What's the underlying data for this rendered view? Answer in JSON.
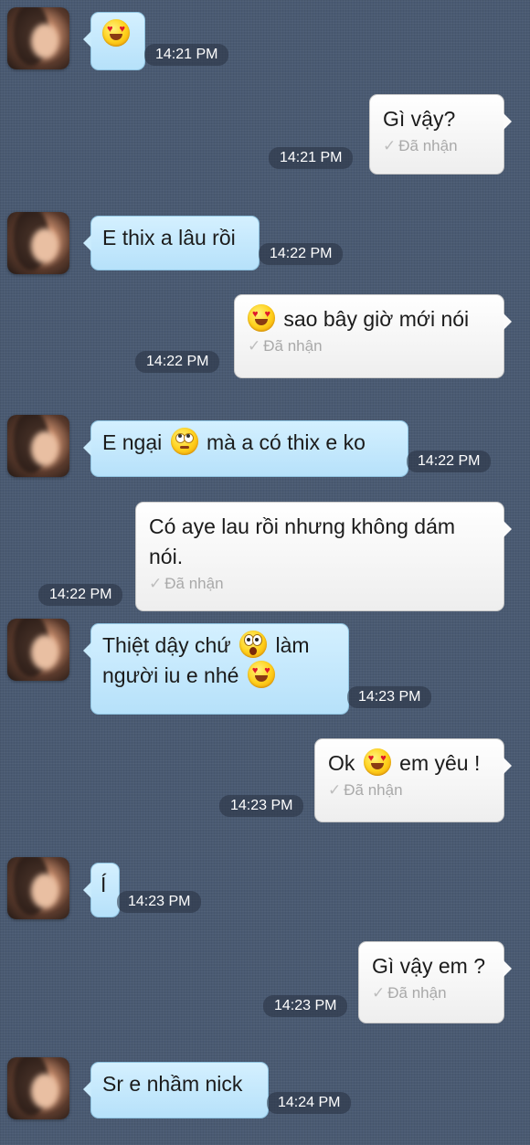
{
  "messages": [
    {
      "emoji": "heart-eyes-emoji",
      "time": "14:21 PM"
    },
    {
      "text": "Gì vậy?",
      "time": "14:21 PM",
      "status": "Đã nhận"
    },
    {
      "text": "E thix a lâu rồi",
      "time": "14:22 PM"
    },
    {
      "text": "sao bây giờ mới nói",
      "emoji": "heart-eyes-emoji",
      "time": "14:22 PM",
      "status": "Đã nhận"
    },
    {
      "text_before": "E ngại",
      "emoji": "eye-roll-emoji",
      "text_after": "mà a có thix e ko",
      "time": "14:22 PM"
    },
    {
      "text": "Có aye lau rồi nhưng không dám nói.",
      "time": "14:22 PM",
      "status": "Đã nhận"
    },
    {
      "line1_before": "Thiệt dậy chứ",
      "emoji1": "shocked-emoji",
      "line1_after": "làm",
      "line2": "người iu e nhé",
      "emoji2": "heart-eyes-emoji",
      "time": "14:23 PM"
    },
    {
      "text_before": "Ok",
      "emoji": "heart-eyes-emoji",
      "text_after": "em yêu !",
      "time": "14:23 PM",
      "status": "Đã nhận"
    },
    {
      "text": "Í",
      "time": "14:23 PM"
    },
    {
      "text": "Gì vậy em ?",
      "time": "14:23 PM",
      "status": "Đã nhận"
    },
    {
      "text": "Sr e nhầm nick",
      "time": "14:24 PM"
    }
  ],
  "colors": {
    "background": "#4a5a72",
    "incoming_bubble": "#c8eafd",
    "outgoing_bubble": "#ffffff",
    "status_text": "#a9a9a9"
  }
}
